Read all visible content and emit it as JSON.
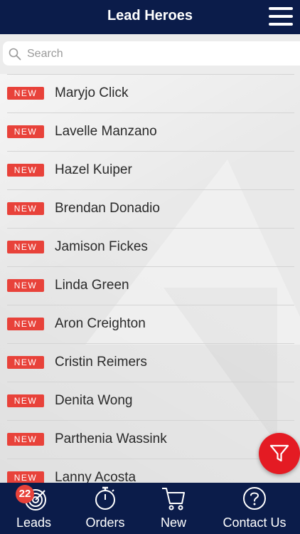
{
  "header": {
    "title": "Lead Heroes",
    "menu_icon": "hamburger-menu-icon"
  },
  "search": {
    "placeholder": "Search",
    "value": ""
  },
  "leads": [
    {
      "badge": "NEW",
      "name": "Maryjo Click"
    },
    {
      "badge": "NEW",
      "name": "Lavelle Manzano"
    },
    {
      "badge": "NEW",
      "name": "Hazel Kuiper"
    },
    {
      "badge": "NEW",
      "name": "Brendan Donadio"
    },
    {
      "badge": "NEW",
      "name": "Jamison Fickes"
    },
    {
      "badge": "NEW",
      "name": "Linda Green"
    },
    {
      "badge": "NEW",
      "name": "Aron Creighton"
    },
    {
      "badge": "NEW",
      "name": "Cristin Reimers"
    },
    {
      "badge": "NEW",
      "name": "Denita Wong"
    },
    {
      "badge": "NEW",
      "name": "Parthenia Wassink"
    },
    {
      "badge": "NEW",
      "name": "Lanny Acosta"
    }
  ],
  "fab": {
    "icon": "filter-icon"
  },
  "tabbar": {
    "leads": {
      "label": "Leads",
      "badge": "22",
      "icon": "target-icon"
    },
    "orders": {
      "label": "Orders",
      "icon": "stopwatch-icon"
    },
    "new": {
      "label": "New",
      "icon": "cart-icon"
    },
    "contact": {
      "label": "Contact Us",
      "icon": "question-circle-icon"
    }
  },
  "colors": {
    "navy": "#0b1c4a",
    "badge_red": "#e8423a",
    "fab_red": "#e41b23"
  }
}
